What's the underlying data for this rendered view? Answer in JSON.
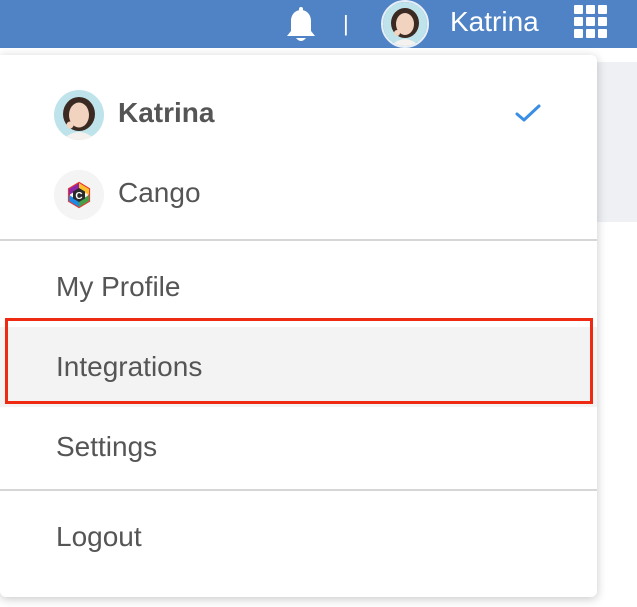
{
  "header": {
    "user_name": "Katrina",
    "separator": "|",
    "bell_icon": "bell-icon",
    "apps_icon": "grid-apps-icon",
    "background_color": "#4f83c5"
  },
  "account_menu": {
    "accounts": [
      {
        "name": "Katrina",
        "selected": true,
        "avatar": "user-avatar"
      },
      {
        "name": "Cango",
        "selected": false,
        "avatar": "cango-logo"
      }
    ],
    "check_color": "#3a8ee6",
    "items": [
      {
        "label": "My Profile"
      },
      {
        "label": "Integrations",
        "highlighted": true
      },
      {
        "label": "Settings"
      },
      {
        "label": "Logout"
      }
    ],
    "highlight_border_color": "#ef2a13"
  }
}
